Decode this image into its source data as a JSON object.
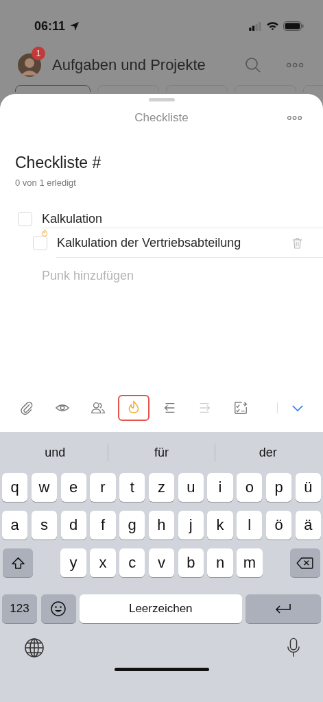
{
  "status_bar": {
    "time": "06:11"
  },
  "header": {
    "badge": "1",
    "title": "Aufgaben und Projekte"
  },
  "filter_chips": [
    {
      "selected": true
    },
    {
      "selected": false
    },
    {
      "selected": false
    },
    {
      "selected": false
    },
    {
      "selected": false
    }
  ],
  "sheet": {
    "title": "Checkliste",
    "heading": "Checkliste #",
    "progress": "0 von 1 erledigt",
    "items": [
      {
        "text": "Kalkulation",
        "checked": false,
        "children": [
          {
            "text": "Kalkulation der Vertriebsabteilung",
            "checked": false,
            "priority": true
          }
        ]
      }
    ],
    "add_placeholder": "Punk hinzufügen"
  },
  "toolbar": [
    {
      "kind": "attach",
      "selected": false,
      "disabled": false
    },
    {
      "kind": "watch",
      "selected": false,
      "disabled": false
    },
    {
      "kind": "people",
      "selected": false,
      "disabled": false
    },
    {
      "kind": "priority",
      "selected": true,
      "disabled": false
    },
    {
      "kind": "outdent",
      "selected": false,
      "disabled": false
    },
    {
      "kind": "indent",
      "selected": false,
      "disabled": true
    },
    {
      "kind": "convert",
      "selected": false,
      "disabled": false
    }
  ],
  "keyboard": {
    "suggestions": [
      "und",
      "für",
      "der"
    ],
    "top_letters": [
      "q",
      "w",
      "e",
      "r",
      "t",
      "z",
      "u",
      "i",
      "o",
      "p",
      "ü"
    ],
    "middle_letters": [
      "a",
      "s",
      "d",
      "f",
      "g",
      "h",
      "j",
      "k",
      "l",
      "ö",
      "ä"
    ],
    "bottom_letters": [
      "y",
      "x",
      "c",
      "v",
      "b",
      "n",
      "m"
    ],
    "numbers_key": "123",
    "space_key": "Leerzeichen"
  }
}
